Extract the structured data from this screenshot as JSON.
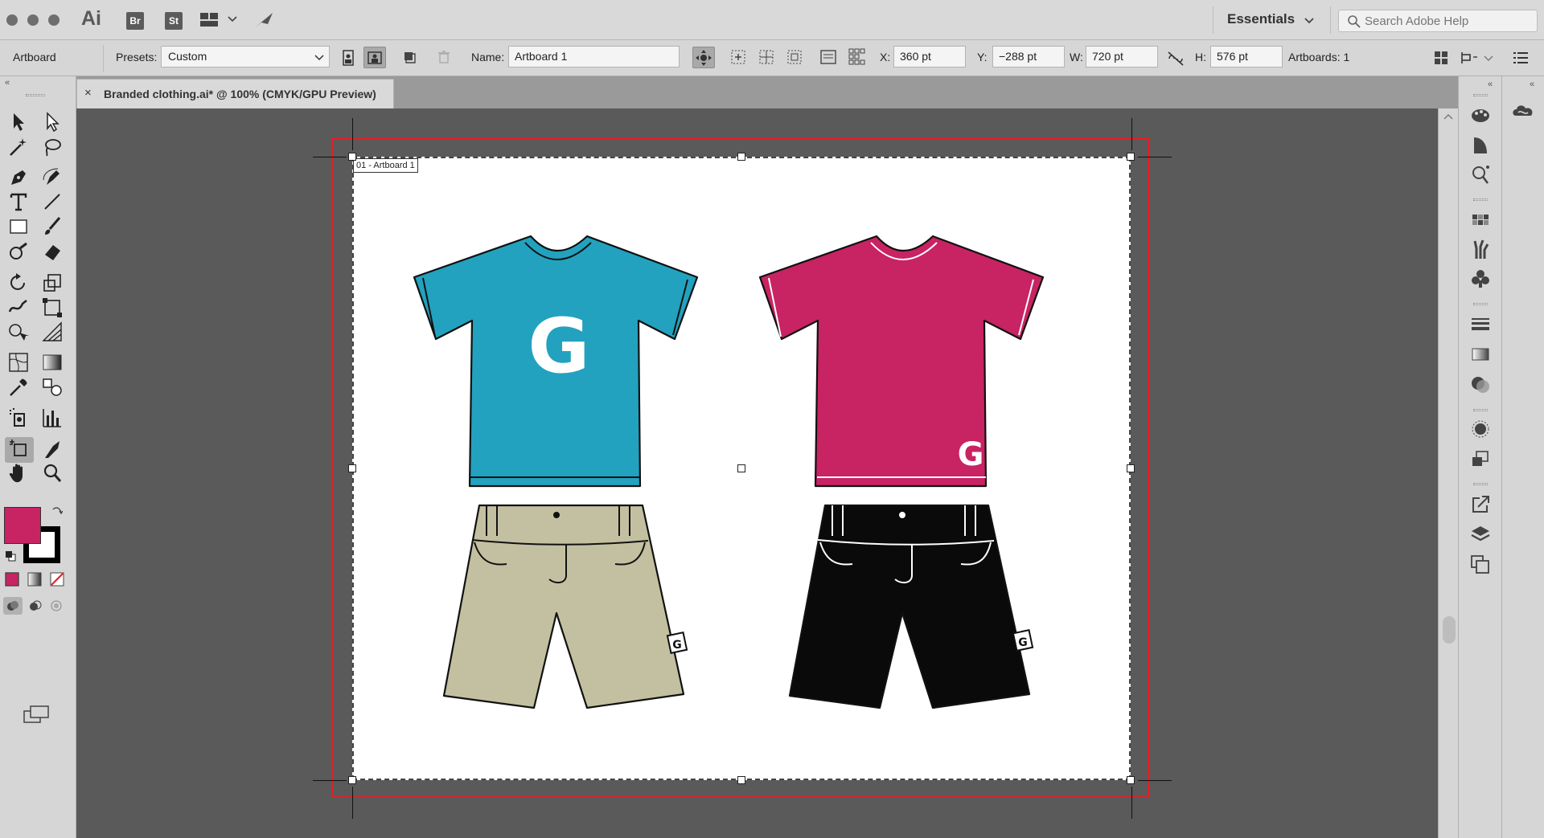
{
  "app": {
    "logo": "Ai",
    "icons": [
      "Br",
      "St"
    ]
  },
  "workspace": {
    "label": "Essentials"
  },
  "search": {
    "placeholder": "Search Adobe Help"
  },
  "control_bar": {
    "tool_name": "Artboard",
    "presets_label": "Presets:",
    "presets_value": "Custom",
    "name_label": "Name:",
    "name_value": "Artboard 1",
    "x_label": "X:",
    "x_value": "360 pt",
    "y_label": "Y:",
    "y_value": "−288 pt",
    "w_label": "W:",
    "w_value": "720 pt",
    "h_label": "H:",
    "h_value": "576 pt",
    "artboards_text": "Artboards: 1"
  },
  "document_tab": {
    "close": "×",
    "title": "Branded clothing.ai* @ 100% (CMYK/GPU Preview)"
  },
  "artboard": {
    "label": "01 - Artboard 1"
  },
  "artwork": {
    "items": [
      {
        "name": "tshirt",
        "color": "#22a2bf",
        "logo": "G"
      },
      {
        "name": "tshirt",
        "color": "#c82363",
        "logo": "G"
      },
      {
        "name": "shorts",
        "color": "#c3c0a1",
        "logo": "G"
      },
      {
        "name": "shorts",
        "color": "#0a0a0a",
        "logo": "G"
      }
    ]
  },
  "colors": {
    "fill": "#c82363",
    "stroke": "#000000",
    "bleed": "#e31d23"
  },
  "tools": [
    "selection-icon",
    "direct-selection-icon",
    "magic-wand-icon",
    "lasso-icon",
    "pen-icon",
    "curvature-icon",
    "type-icon",
    "line-icon",
    "rectangle-icon",
    "paintbrush-icon",
    "shaper-icon",
    "eraser-icon",
    "rotate-icon",
    "scale-icon",
    "warp-icon",
    "free-transform-icon",
    "shape-builder-icon",
    "perspective-grid-icon",
    "mesh-icon",
    "gradient-icon",
    "eyedropper-icon",
    "blend-icon",
    "symbol-sprayer-icon",
    "column-graph-icon",
    "artboard-icon",
    "slice-icon",
    "hand-icon",
    "zoom-icon"
  ],
  "panels": [
    "color-guide-icon",
    "color-icon",
    "gradient-icon",
    "swatches-icon",
    "brushes-icon",
    "symbols-icon",
    "stroke-icon",
    "transparency-icon",
    "appearance-icon",
    "graphic-styles-icon",
    "export-icon",
    "layers-icon",
    "artboards-panel-icon"
  ]
}
